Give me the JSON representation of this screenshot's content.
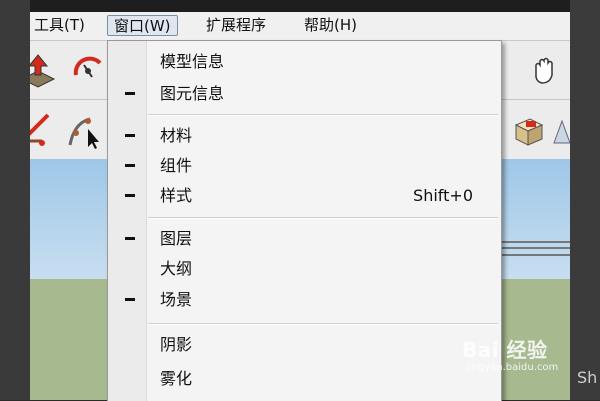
{
  "menubar": {
    "items": [
      {
        "label": "工具(T)"
      },
      {
        "label": "窗口(W)"
      },
      {
        "label": "扩展程序"
      },
      {
        "label": "帮助(H)"
      }
    ]
  },
  "window_menu": {
    "items": [
      {
        "label": "模型信息",
        "checked": false
      },
      {
        "label": "图元信息",
        "checked": true
      },
      {
        "label": "材料",
        "checked": true
      },
      {
        "label": "组件",
        "checked": true
      },
      {
        "label": "样式",
        "checked": true,
        "shortcut": "Shift+0"
      },
      {
        "label": "图层",
        "checked": true
      },
      {
        "label": "大纲",
        "checked": false
      },
      {
        "label": "场景",
        "checked": true
      },
      {
        "label": "阴影",
        "checked": false
      },
      {
        "label": "雾化",
        "checked": false
      }
    ]
  },
  "toolbar": {
    "icons": [
      "push-pull-icon",
      "rotate-icon",
      "hand-icon",
      "eraser-icon",
      "select-arc-icon",
      "component-icon",
      "section-icon"
    ]
  },
  "watermark": {
    "main": "Bai 经验",
    "sub": "jingyan.baidu.com"
  },
  "right_edge_text": "Sh"
}
